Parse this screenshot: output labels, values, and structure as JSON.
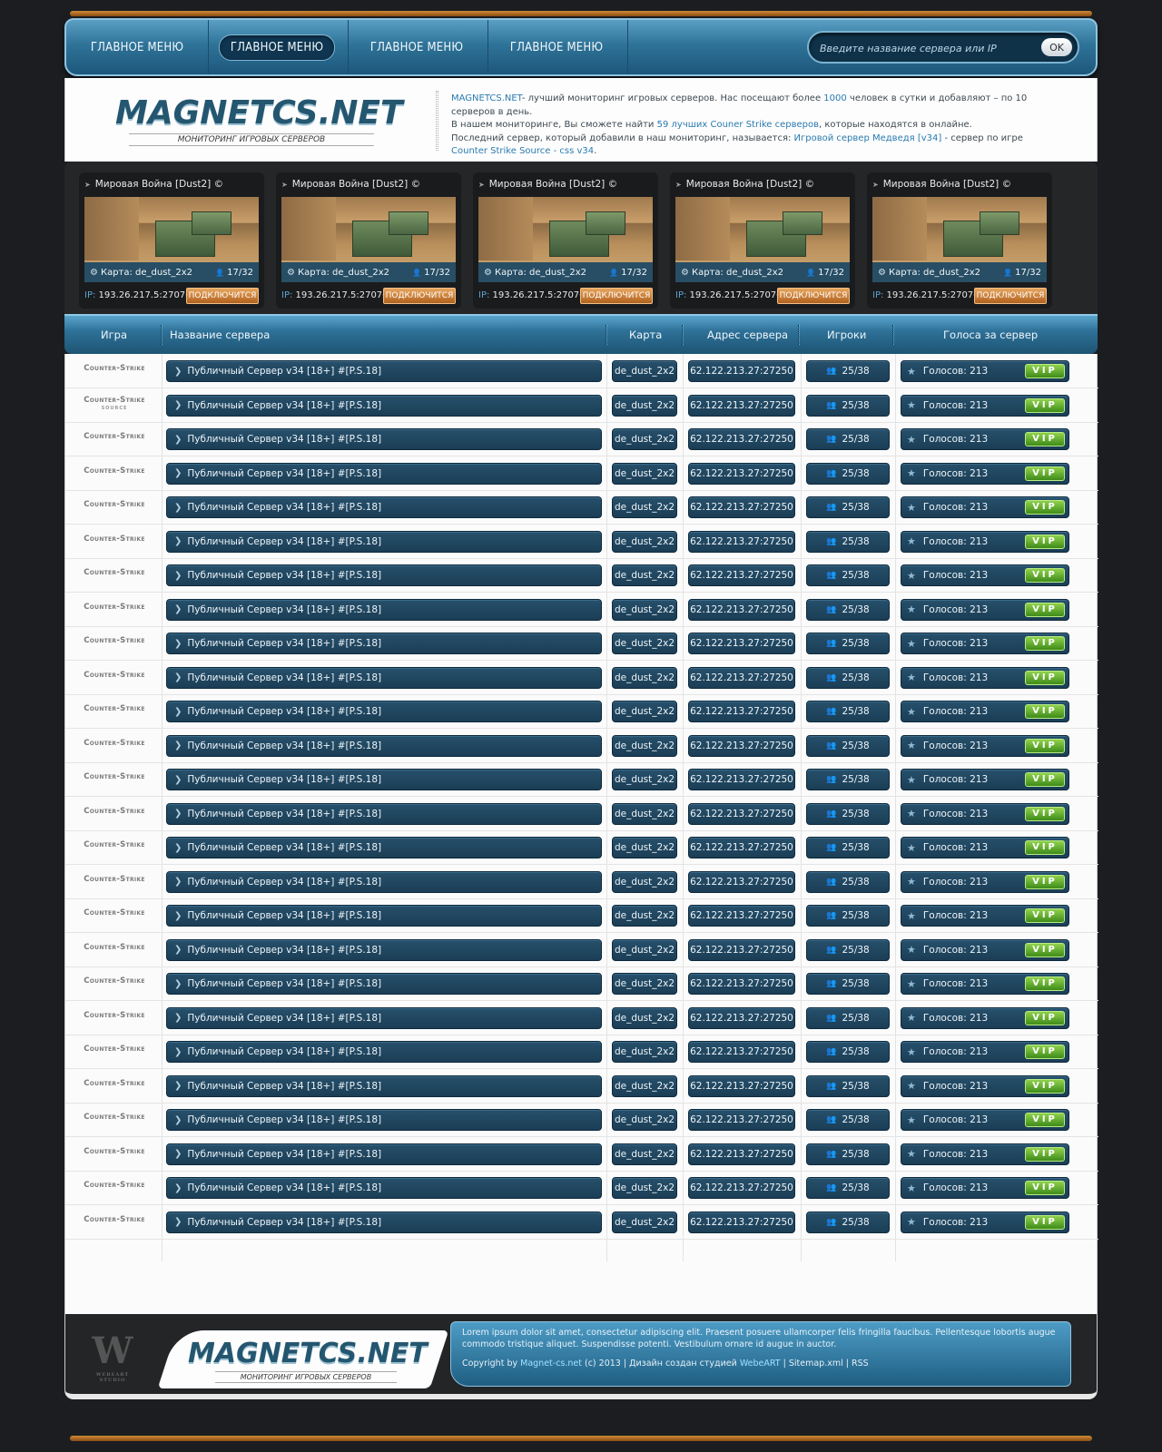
{
  "nav": {
    "items": [
      "ГЛАВНОЕ МЕНЮ",
      "ГЛАВНОЕ МЕНЮ",
      "ГЛАВНОЕ МЕНЮ",
      "ГЛАВНОЕ МЕНЮ"
    ],
    "active_index": 1,
    "search_placeholder": "Введите название сервера или IP",
    "search_button": "OK"
  },
  "header": {
    "logo_title": "MAGNETCS.NET",
    "logo_subtitle": "МОНИТОРИНГ ИГРОВЫХ СЕРВЕРОВ",
    "site_name": "MAGNETCS.NET",
    "text_1": "- лучший мониторинг игровых серверов. Нас посещают более ",
    "visitors": "1000",
    "text_2": " человек в сутки и добавляют – по 10 серверов в день.",
    "text_3": "В нашем мониторинге, Вы сможете найти ",
    "best_link": "59 лучших Couner Strike серверов",
    "text_4": ", которые находятся в онлайне.",
    "text_5": "Последний сервер, который добавили в наш мониторинг, называется: ",
    "last_server_link": "Игровой сервер Медведя [v34]",
    "text_6": " - сервер по игре ",
    "game_link": "Counter Strike Source - css v34",
    "text_7": "."
  },
  "featured": [
    {
      "title": "Мировая Война [Dust2] ©",
      "map": "Карта: de_dust_2x2",
      "players": "17/32",
      "ip_label": "IP:",
      "ip": "193.26.217.5:27076",
      "connect": "ПОДКЛЮЧИТСЯ"
    },
    {
      "title": "Мировая Война [Dust2] ©",
      "map": "Карта: de_dust_2x2",
      "players": "17/32",
      "ip_label": "IP:",
      "ip": "193.26.217.5:27076",
      "connect": "ПОДКЛЮЧИТСЯ"
    },
    {
      "title": "Мировая Война [Dust2] ©",
      "map": "Карта: de_dust_2x2",
      "players": "17/32",
      "ip_label": "IP:",
      "ip": "193.26.217.5:27076",
      "connect": "ПОДКЛЮЧИТСЯ"
    },
    {
      "title": "Мировая Война [Dust2] ©",
      "map": "Карта: de_dust_2x2",
      "players": "17/32",
      "ip_label": "IP:",
      "ip": "193.26.217.5:27076",
      "connect": "ПОДКЛЮЧИТСЯ"
    },
    {
      "title": "Мировая Война [Dust2] ©",
      "map": "Карта: de_dust_2x2",
      "players": "17/32",
      "ip_label": "IP:",
      "ip": "193.26.217.5:27076",
      "connect": "ПОДКЛЮЧИТСЯ"
    }
  ],
  "table": {
    "headers": {
      "game": "Игра",
      "name": "Название сервера",
      "map": "Карта",
      "address": "Адрес сервера",
      "players": "Игроки",
      "votes": "Голоса за сервер"
    },
    "rows": [
      {
        "game": "Counter-Strike",
        "name": "Публичный Сервер v34 [18+] #[P.S.18]",
        "map": "de_dust_2x2",
        "address": "62.122.213.27:27250",
        "players": "25/38",
        "votes": "Голосов: 213",
        "vip": "VIP"
      },
      {
        "game": "Counter-Strike",
        "game_sub": "SOURCE",
        "name": "Публичный Сервер v34 [18+] #[P.S.18]",
        "map": "de_dust_2x2",
        "address": "62.122.213.27:27250",
        "players": "25/38",
        "votes": "Голосов: 213",
        "vip": "VIP"
      },
      {
        "game": "Counter-Strike",
        "name": "Публичный Сервер v34 [18+] #[P.S.18]",
        "map": "de_dust_2x2",
        "address": "62.122.213.27:27250",
        "players": "25/38",
        "votes": "Голосов: 213",
        "vip": "VIP"
      },
      {
        "game": "Counter-Strike",
        "name": "Публичный Сервер v34 [18+] #[P.S.18]",
        "map": "de_dust_2x2",
        "address": "62.122.213.27:27250",
        "players": "25/38",
        "votes": "Голосов: 213",
        "vip": "VIP"
      },
      {
        "game": "Counter-Strike",
        "name": "Публичный Сервер v34 [18+] #[P.S.18]",
        "map": "de_dust_2x2",
        "address": "62.122.213.27:27250",
        "players": "25/38",
        "votes": "Голосов: 213",
        "vip": "VIP"
      },
      {
        "game": "Counter-Strike",
        "name": "Публичный Сервер v34 [18+] #[P.S.18]",
        "map": "de_dust_2x2",
        "address": "62.122.213.27:27250",
        "players": "25/38",
        "votes": "Голосов: 213",
        "vip": "VIP"
      },
      {
        "game": "Counter-Strike",
        "name": "Публичный Сервер v34 [18+] #[P.S.18]",
        "map": "de_dust_2x2",
        "address": "62.122.213.27:27250",
        "players": "25/38",
        "votes": "Голосов: 213",
        "vip": "VIP"
      },
      {
        "game": "Counter-Strike",
        "name": "Публичный Сервер v34 [18+] #[P.S.18]",
        "map": "de_dust_2x2",
        "address": "62.122.213.27:27250",
        "players": "25/38",
        "votes": "Голосов: 213",
        "vip": "VIP"
      },
      {
        "game": "Counter-Strike",
        "name": "Публичный Сервер v34 [18+] #[P.S.18]",
        "map": "de_dust_2x2",
        "address": "62.122.213.27:27250",
        "players": "25/38",
        "votes": "Голосов: 213",
        "vip": "VIP"
      },
      {
        "game": "Counter-Strike",
        "name": "Публичный Сервер v34 [18+] #[P.S.18]",
        "map": "de_dust_2x2",
        "address": "62.122.213.27:27250",
        "players": "25/38",
        "votes": "Голосов: 213",
        "vip": "VIP"
      },
      {
        "game": "Counter-Strike",
        "name": "Публичный Сервер v34 [18+] #[P.S.18]",
        "map": "de_dust_2x2",
        "address": "62.122.213.27:27250",
        "players": "25/38",
        "votes": "Голосов: 213",
        "vip": "VIP"
      },
      {
        "game": "Counter-Strike",
        "name": "Публичный Сервер v34 [18+] #[P.S.18]",
        "map": "de_dust_2x2",
        "address": "62.122.213.27:27250",
        "players": "25/38",
        "votes": "Голосов: 213",
        "vip": "VIP"
      },
      {
        "game": "Counter-Strike",
        "name": "Публичный Сервер v34 [18+] #[P.S.18]",
        "map": "de_dust_2x2",
        "address": "62.122.213.27:27250",
        "players": "25/38",
        "votes": "Голосов: 213",
        "vip": "VIP"
      },
      {
        "game": "Counter-Strike",
        "name": "Публичный Сервер v34 [18+] #[P.S.18]",
        "map": "de_dust_2x2",
        "address": "62.122.213.27:27250",
        "players": "25/38",
        "votes": "Голосов: 213",
        "vip": "VIP"
      },
      {
        "game": "Counter-Strike",
        "name": "Публичный Сервер v34 [18+] #[P.S.18]",
        "map": "de_dust_2x2",
        "address": "62.122.213.27:27250",
        "players": "25/38",
        "votes": "Голосов: 213",
        "vip": "VIP"
      },
      {
        "game": "Counter-Strike",
        "name": "Публичный Сервер v34 [18+] #[P.S.18]",
        "map": "de_dust_2x2",
        "address": "62.122.213.27:27250",
        "players": "25/38",
        "votes": "Голосов: 213",
        "vip": "VIP"
      },
      {
        "game": "Counter-Strike",
        "name": "Публичный Сервер v34 [18+] #[P.S.18]",
        "map": "de_dust_2x2",
        "address": "62.122.213.27:27250",
        "players": "25/38",
        "votes": "Голосов: 213",
        "vip": "VIP"
      },
      {
        "game": "Counter-Strike",
        "name": "Публичный Сервер v34 [18+] #[P.S.18]",
        "map": "de_dust_2x2",
        "address": "62.122.213.27:27250",
        "players": "25/38",
        "votes": "Голосов: 213",
        "vip": "VIP"
      },
      {
        "game": "Counter-Strike",
        "name": "Публичный Сервер v34 [18+] #[P.S.18]",
        "map": "de_dust_2x2",
        "address": "62.122.213.27:27250",
        "players": "25/38",
        "votes": "Голосов: 213",
        "vip": "VIP"
      },
      {
        "game": "Counter-Strike",
        "name": "Публичный Сервер v34 [18+] #[P.S.18]",
        "map": "de_dust_2x2",
        "address": "62.122.213.27:27250",
        "players": "25/38",
        "votes": "Голосов: 213",
        "vip": "VIP"
      },
      {
        "game": "Counter-Strike",
        "name": "Публичный Сервер v34 [18+] #[P.S.18]",
        "map": "de_dust_2x2",
        "address": "62.122.213.27:27250",
        "players": "25/38",
        "votes": "Голосов: 213",
        "vip": "VIP"
      },
      {
        "game": "Counter-Strike",
        "name": "Публичный Сервер v34 [18+] #[P.S.18]",
        "map": "de_dust_2x2",
        "address": "62.122.213.27:27250",
        "players": "25/38",
        "votes": "Голосов: 213",
        "vip": "VIP"
      },
      {
        "game": "Counter-Strike",
        "name": "Публичный Сервер v34 [18+] #[P.S.18]",
        "map": "de_dust_2x2",
        "address": "62.122.213.27:27250",
        "players": "25/38",
        "votes": "Голосов: 213",
        "vip": "VIP"
      },
      {
        "game": "Counter-Strike",
        "name": "Публичный Сервер v34 [18+] #[P.S.18]",
        "map": "de_dust_2x2",
        "address": "62.122.213.27:27250",
        "players": "25/38",
        "votes": "Голосов: 213",
        "vip": "VIP"
      },
      {
        "game": "Counter-Strike",
        "name": "Публичный Сервер v34 [18+] #[P.S.18]",
        "map": "de_dust_2x2",
        "address": "62.122.213.27:27250",
        "players": "25/38",
        "votes": "Голосов: 213",
        "vip": "VIP"
      },
      {
        "game": "Counter-Strike",
        "name": "Публичный Сервер v34 [18+] #[P.S.18]",
        "map": "de_dust_2x2",
        "address": "62.122.213.27:27250",
        "players": "25/38",
        "votes": "Голосов: 213",
        "vip": "VIP"
      }
    ]
  },
  "footer": {
    "logo_title": "MAGNETCS.NET",
    "logo_subtitle": "МОНИТОРИНГ ИГРОВЫХ СЕРВЕРОВ",
    "badge_letter": "W",
    "badge_caption": "WEBEART STUDIO",
    "lorem": "Lorem ipsum dolor sit amet, consectetur adipiscing elit. Praesent posuere ullamcorper felis fringilla faucibus. Pellentesque lobortis augue commodo tristique aliquet. Suspendisse potenti. Vestibulum ornare id augue in auctor.",
    "copyright_prefix": "Copyright by ",
    "copyright_link": "Magnet-cs.net",
    "copyright_year": " (c) 2013  |  Дизайн создан студией ",
    "studio_link": "WebeART",
    "sep": "  |  ",
    "sitemap": "Sitemap.xml",
    "rss": "RSS"
  },
  "colors": {
    "nav_blue": "#2f7398",
    "pill_bg": "#1f4560",
    "vip_green": "#5fae2c",
    "connect_orange": "#d08a36",
    "link_blue": "#2a7bb0"
  }
}
